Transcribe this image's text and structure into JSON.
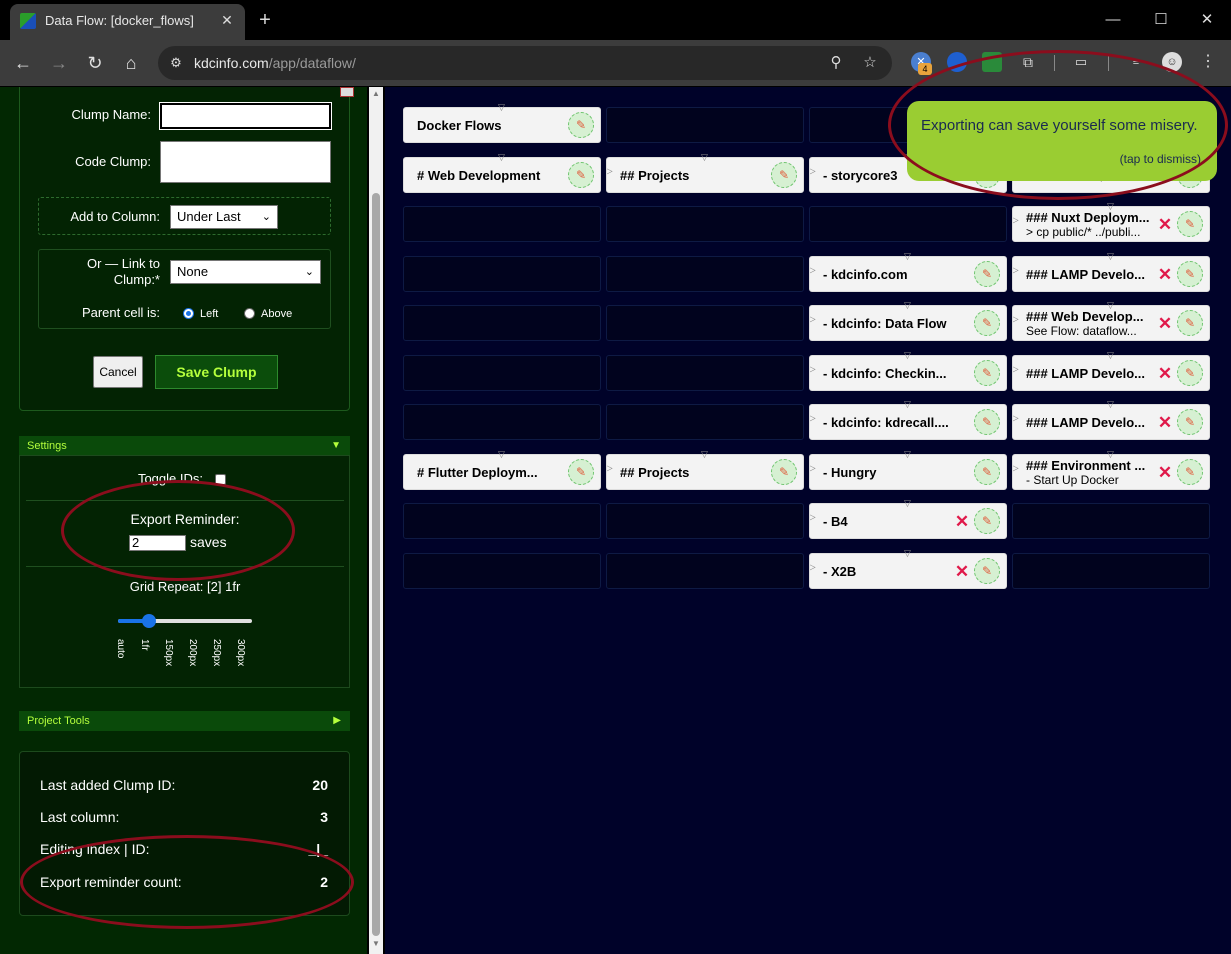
{
  "browser": {
    "tab_title": "Data Flow: [docker_flows]",
    "url_host": "kdcinfo.com",
    "url_path": "/app/dataflow/",
    "ext_badge": "4"
  },
  "form": {
    "clump_name_label": "Clump Name:",
    "code_clump_label": "Code Clump:",
    "add_to_column_label": "Add to Column:",
    "add_to_column_value": "Under Last",
    "link_label_line1": "Or — Link to",
    "link_label_line2": "Clump:*",
    "link_value": "None",
    "parent_label": "Parent cell is:",
    "radio_left": "Left",
    "radio_above": "Above",
    "cancel_label": "Cancel",
    "save_label": "Save Clump"
  },
  "settings": {
    "header": "Settings",
    "header_arrow": "▼",
    "toggle_ids_label": "Toggle IDs:",
    "export_reminder_label": "Export Reminder:",
    "export_reminder_value": "2",
    "export_reminder_unit": "saves",
    "grid_repeat_label": "Grid Repeat: [2] 1fr",
    "grid_repeat_level": 1,
    "ticks": [
      "auto",
      "1fr",
      "150px",
      "200px",
      "250px",
      "300px"
    ]
  },
  "project_tools": {
    "header": "Project Tools",
    "header_arrow": "▶"
  },
  "stats": [
    {
      "label": "Last added Clump ID:",
      "value": "20"
    },
    {
      "label": "Last column:",
      "value": "3"
    },
    {
      "label": "Editing index | ID:",
      "value": "_|_"
    },
    {
      "label": "Export reminder count:",
      "value": "2"
    }
  ],
  "grid": {
    "columns": 4,
    "rows": 10,
    "clumps": [
      {
        "row": 0,
        "col": 0,
        "name": "Docker Flows",
        "del": false
      },
      {
        "row": 1,
        "col": 0,
        "name": "# Web Development",
        "del": false
      },
      {
        "row": 1,
        "col": 1,
        "name": "## Projects",
        "del": false
      },
      {
        "row": 1,
        "col": 2,
        "name": "- storycore3",
        "del": false
      },
      {
        "row": 1,
        "col": 3,
        "name": "",
        "sub": "> cd ~/Developmen...",
        "del": false
      },
      {
        "row": 2,
        "col": 3,
        "name": "### Nuxt Deploym...",
        "sub": "> cp public/* ../publi...",
        "del": true
      },
      {
        "row": 3,
        "col": 2,
        "name": "- kdcinfo.com",
        "del": false
      },
      {
        "row": 3,
        "col": 3,
        "name": "### LAMP Develo...",
        "del": true
      },
      {
        "row": 4,
        "col": 2,
        "name": "- kdcinfo: Data Flow",
        "del": false
      },
      {
        "row": 4,
        "col": 3,
        "name": "### Web Develop...",
        "sub": "See Flow: dataflow...",
        "del": true
      },
      {
        "row": 5,
        "col": 2,
        "name": "- kdcinfo: Checkin...",
        "del": false
      },
      {
        "row": 5,
        "col": 3,
        "name": "### LAMP Develo...",
        "del": true
      },
      {
        "row": 6,
        "col": 2,
        "name": "- kdcinfo: kdrecall....",
        "del": false
      },
      {
        "row": 6,
        "col": 3,
        "name": "### LAMP Develo...",
        "del": true
      },
      {
        "row": 7,
        "col": 0,
        "name": "# Flutter Deploym...",
        "del": false
      },
      {
        "row": 7,
        "col": 1,
        "name": "## Projects",
        "del": false
      },
      {
        "row": 7,
        "col": 2,
        "name": "- Hungry",
        "del": false
      },
      {
        "row": 7,
        "col": 3,
        "name": "### Environment ...",
        "sub": "- Start Up Docker",
        "del": true
      },
      {
        "row": 8,
        "col": 2,
        "name": "- B4",
        "del": true
      },
      {
        "row": 9,
        "col": 2,
        "name": "- X2B",
        "del": true
      }
    ]
  },
  "toast": {
    "message": "Exporting can save yourself some misery.",
    "dismiss": "(tap to dismiss)"
  },
  "colors": {
    "sidebar_bg": "#022802",
    "main_bg": "#000229",
    "accent_green": "#b4ff3c",
    "toast_bg": "#9acd32",
    "annotation": "#8b0d1d"
  }
}
